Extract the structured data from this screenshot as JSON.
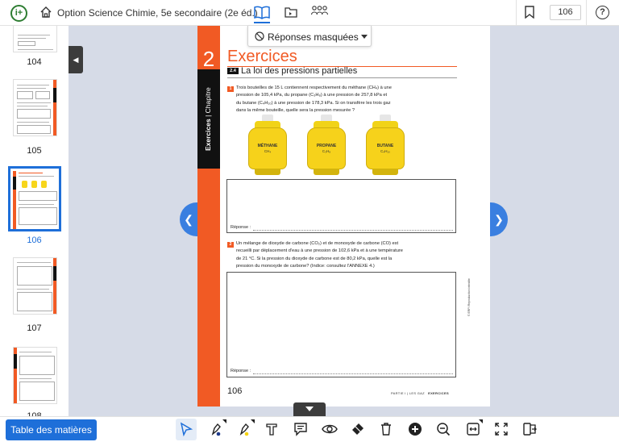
{
  "app": {
    "logo_glyph": "i+",
    "doc_title": "Option Science Chimie, 5e secondaire (2e éd.)",
    "current_page": "106",
    "help_glyph": "?",
    "accent_color": "#1e6fd9"
  },
  "sidebar": {
    "thumbnails": [
      {
        "label": "104"
      },
      {
        "label": "105"
      },
      {
        "label": "106",
        "selected": true
      },
      {
        "label": "107"
      },
      {
        "label": "108"
      }
    ]
  },
  "answers_dropdown": {
    "label": "Réponses masquées"
  },
  "page": {
    "chapter_number": "2",
    "side_label_bold": "Exercices",
    "side_label_rest": " | Chapitre",
    "title": "Exercices",
    "section_number": "2.4",
    "section_title": "La loi des pressions partielles",
    "exercise1": {
      "number": "1",
      "lines": [
        "Trois bouteilles de 15 L contiennent respectivement du méthane (CH₄) à une",
        "pression de 105,4 kPa, du propane (C₃H₈) à une pression de 257,8 kPa et",
        "du butane (C₄H₁₀) à une pression de 178,3 kPa. Si on transfère les trois gaz",
        "dans la même bouteille, quelle sera la pression mesurée ?"
      ],
      "tanks": [
        {
          "name": "MÉTHANE",
          "formula": "CH₄"
        },
        {
          "name": "PROPANE",
          "formula": "C₃H₈"
        },
        {
          "name": "BUTANE",
          "formula": "C₄H₁₀"
        }
      ],
      "answer_label": "Réponse :"
    },
    "exercise2": {
      "number": "2",
      "lines": [
        "Un mélange de dioxyde de carbone (CO₂) et de monoxyde de carbone (CO) est",
        "recueilli par déplacement d'eau à une pression de 102,6 kPa et à une température",
        "de 21 °C. Si la pression du dioxyde de carbone est de 80,2 kPa, quelle est la",
        "pression du monoxyde de carbone? (Indice: consultez l'ANNEXE 4.)"
      ],
      "answer_label": "Réponse :"
    },
    "credit": "© ERPI Reproduction interdite",
    "folio": "106",
    "footer_part": "PARTIE I",
    "footer_sep": " | ",
    "footer_topic": "LES GAZ",
    "footer_section": "EXERCICES"
  },
  "toolbar": {
    "toc_label": "Table des matières",
    "tools": [
      "cursor-icon",
      "pen-icon",
      "highlighter-icon",
      "text-icon",
      "comment-icon",
      "eye-icon",
      "eraser-icon",
      "trash-icon",
      "zoom-in-icon",
      "zoom-out-icon",
      "fit-width-icon",
      "fullscreen-icon",
      "dual-page-icon"
    ]
  }
}
